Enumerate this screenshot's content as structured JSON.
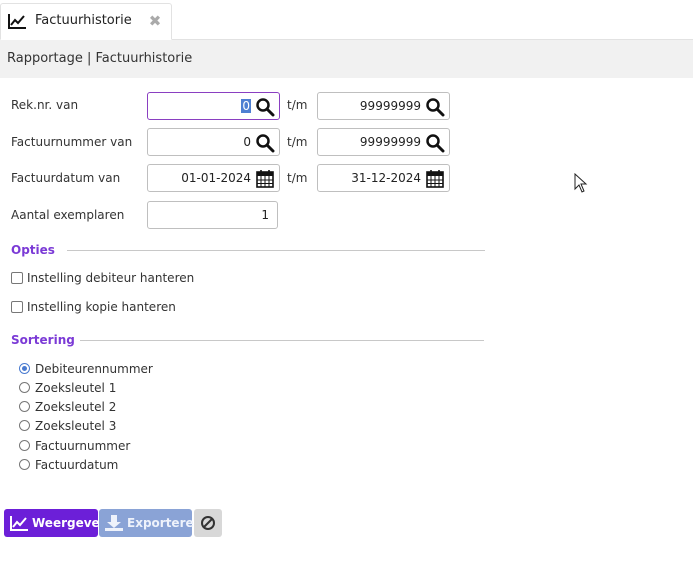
{
  "tab": {
    "label": "Factuurhistorie",
    "icon": "line-chart-icon",
    "close_icon": "close-icon",
    "close_glyph": "✖"
  },
  "breadcrumb": "Rapportage | Factuurhistorie",
  "form": {
    "rek": {
      "label": "Rek.nr. van",
      "from": "0",
      "to_label": "t/m",
      "to": "99999999"
    },
    "factuurnummer": {
      "label": "Factuurnummer van",
      "from": "0",
      "to_label": "t/m",
      "to": "99999999"
    },
    "factuurdatum": {
      "label": "Factuurdatum van",
      "from": "01-01-2024",
      "to_label": "t/m",
      "to": "31-12-2024"
    },
    "exemplaren": {
      "label": "Aantal exemplaren",
      "value": "1"
    }
  },
  "opties": {
    "title": "Opties",
    "items": [
      {
        "label": "Instelling debiteur hanteren",
        "checked": false
      },
      {
        "label": "Instelling kopie hanteren",
        "checked": false
      }
    ]
  },
  "sortering": {
    "title": "Sortering",
    "selected": "Debiteurennummer",
    "options": [
      "Debiteurennummer",
      "Zoeksleutel 1",
      "Zoeksleutel 2",
      "Zoeksleutel 3",
      "Factuurnummer",
      "Factuurdatum"
    ]
  },
  "buttons": {
    "weergeven": "Weergeven",
    "exporteren": "Exporteren",
    "cancel_icon": "ban-icon"
  },
  "colors": {
    "accent": "#6c1fd8",
    "section_title": "#7b3ad6",
    "disabled_button": "#8aa3d6",
    "focus_border": "#8a3fc1",
    "breadcrumb_bg": "#f1f1f1"
  }
}
